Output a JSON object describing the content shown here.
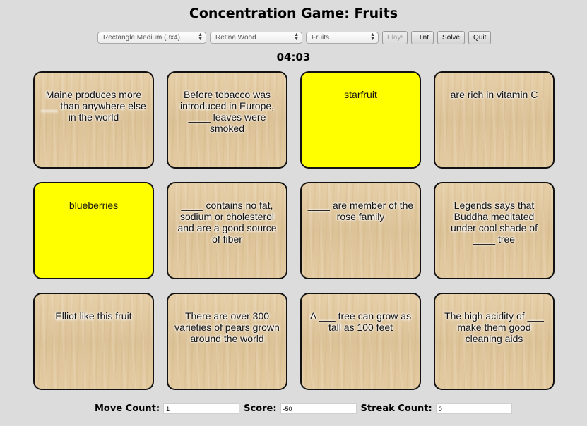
{
  "title": "Concentration Game: Fruits",
  "controls": {
    "size_select": "Rectangle Medium (3x4)",
    "theme_select": "Retina Wood",
    "category_select": "Fruits",
    "play_label": "Play!",
    "hint_label": "Hint",
    "solve_label": "Solve",
    "quit_label": "Quit"
  },
  "timer": "04:03",
  "cards": [
    {
      "text": "Maine produces more ___ than anywhere else in the world",
      "revealed": false
    },
    {
      "text": "Before tobacco was introduced in Europe, ____ leaves were smoked",
      "revealed": false
    },
    {
      "text": "starfruit",
      "revealed": true
    },
    {
      "text": "are rich in vitamin C",
      "revealed": false
    },
    {
      "text": "blueberries",
      "revealed": true
    },
    {
      "text": "____ contains no fat, sodium or cholesterol and are a good source of fiber",
      "revealed": false
    },
    {
      "text": "____ are member of the rose family",
      "revealed": false
    },
    {
      "text": "Legends says that Buddha meditated under cool shade of ____ tree",
      "revealed": false
    },
    {
      "text": "Elliot like this fruit",
      "revealed": false
    },
    {
      "text": "There are over 300 varieties of pears grown around the world",
      "revealed": false
    },
    {
      "text": "A ___ tree can grow as tall as 100 feet",
      "revealed": false
    },
    {
      "text": "The high acidity of ___ make them good cleaning aids",
      "revealed": false
    }
  ],
  "stats": {
    "move_label": "Move Count:",
    "move_value": "1",
    "score_label": "Score:",
    "score_value": "-50",
    "streak_label": "Streak Count:",
    "streak_value": "0"
  },
  "colors": {
    "revealed": "#ffff00",
    "background": "#dcdcdc"
  }
}
